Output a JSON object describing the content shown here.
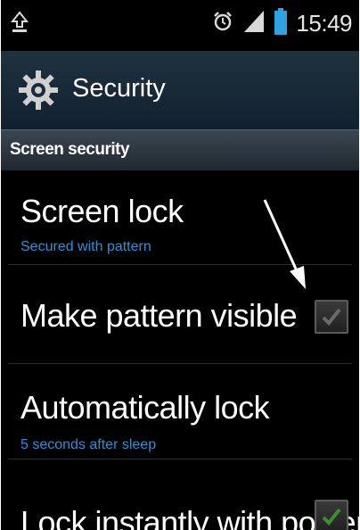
{
  "status_bar": {
    "time": "15:49",
    "icons": [
      "upload-notification-icon",
      "alarm-icon",
      "signal-bars-icon",
      "battery-icon"
    ]
  },
  "action_bar": {
    "title": "Security",
    "icon": "gear-icon"
  },
  "section": {
    "title": "Screen security"
  },
  "settings": [
    {
      "title": "Screen lock",
      "subtitle": "Secured with pattern",
      "checked": null
    },
    {
      "title": "Make pattern visible",
      "subtitle": "",
      "checked": true
    },
    {
      "title": "Automatically lock",
      "subtitle": "5 seconds after sleep",
      "checked": null
    },
    {
      "title": "Lock instantly with power",
      "subtitle": "",
      "checked": true
    }
  ],
  "colors": {
    "background": "#000000",
    "action_bar": "#16293a",
    "accent_subtitle": "#2a91d8",
    "checkmark": "#3a8f2e"
  }
}
